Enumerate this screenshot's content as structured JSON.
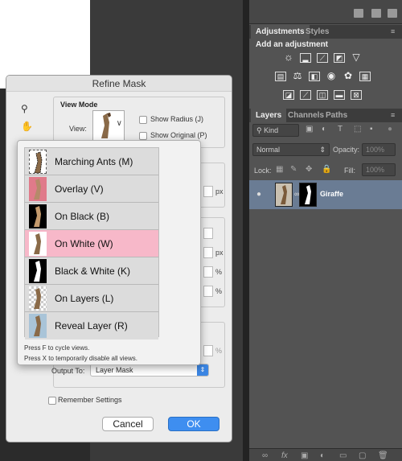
{
  "panels": {
    "adjustments_tab": "Adjustments",
    "styles_tab": "Styles",
    "add_adjustment": "Add an adjustment",
    "layers_tab": "Layers",
    "channels_tab": "Channels",
    "paths_tab": "Paths",
    "kind_filter": "Kind",
    "blend_mode": "Normal",
    "opacity_label": "Opacity:",
    "opacity_value": "100%",
    "lock_label": "Lock:",
    "fill_label": "Fill:",
    "fill_value": "100%",
    "layer_name": "Giraffe"
  },
  "dialog": {
    "title": "Refine Mask",
    "view_mode_title": "View Mode",
    "view_label": "View:",
    "show_radius": "Show Radius (J)",
    "show_original": "Show Original (P)",
    "unit_px_1": "px",
    "unit_px_2": "px",
    "unit_pct_1": "%",
    "unit_pct_2": "%",
    "unit_pct_3": "%",
    "output_to_label": "Output To:",
    "output_to_value": "Layer Mask",
    "remember_settings": "Remember Settings",
    "cancel": "Cancel",
    "ok": "OK"
  },
  "view_popup": {
    "items": [
      {
        "label": "Marching Ants (M)"
      },
      {
        "label": "Overlay (V)"
      },
      {
        "label": "On Black (B)"
      },
      {
        "label": "On White (W)"
      },
      {
        "label": "Black & White (K)"
      },
      {
        "label": "On Layers (L)"
      },
      {
        "label": "Reveal Layer (R)"
      }
    ],
    "selected_index": 3,
    "hint_1": "Press F to cycle views.",
    "hint_2": "Press X to temporarily disable all views."
  },
  "colors": {
    "selected_item": "#f7b8c9",
    "ok_button": "#3e8ef0",
    "layer_selected": "#6a7c94"
  }
}
